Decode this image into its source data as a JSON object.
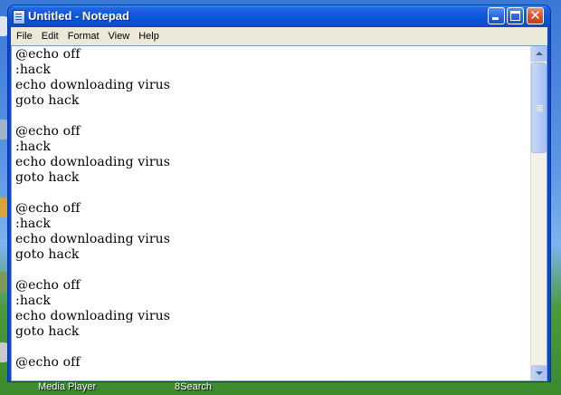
{
  "window": {
    "title": "Untitled - Notepad"
  },
  "menu": {
    "items": [
      "File",
      "Edit",
      "Format",
      "View",
      "Help"
    ]
  },
  "editor": {
    "content": "@echo off\n:hack\necho downloading virus\ngoto hack\n\n@echo off\n:hack\necho downloading virus\ngoto hack\n\n@echo off\n:hack\necho downloading virus\ngoto hack\n\n@echo off\n:hack\necho downloading virus\ngoto hack\n\n@echo off"
  },
  "desktop": {
    "bottom_labels": [
      "Media Player",
      "8Search"
    ]
  },
  "icons": {
    "app": "notepad-icon",
    "minimize": "minimize-icon",
    "maximize": "maximize-icon",
    "close": "close-icon"
  },
  "colors": {
    "titlebar": "#0b58dc",
    "menubar": "#ece9d8",
    "close_button": "#d9512b"
  }
}
